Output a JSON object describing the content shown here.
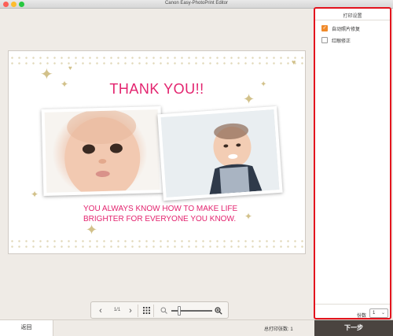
{
  "window": {
    "title": "Canon Easy-PhotoPrint Editor"
  },
  "card": {
    "title": "THANK YOU!!",
    "message_line1": "YOU ALWAYS KNOW HOW TO MAKE LIFE",
    "message_line2": "BRIGHTER FOR EVERYONE YOU KNOW."
  },
  "toolbar": {
    "prev_icon": "chevron-left-icon",
    "page": "1/1",
    "next_icon": "chevron-right-icon",
    "grid_icon": "grid-view-icon",
    "zoom_out_icon": "zoom-out-icon",
    "zoom_in_icon": "zoom-in-icon"
  },
  "panel": {
    "title": "打印设置",
    "options": [
      {
        "label": "自动照片修复",
        "checked": true
      },
      {
        "label": "红眼修正",
        "checked": false
      }
    ],
    "copies_label": "份数",
    "copies_value": "1"
  },
  "bottom": {
    "back_label": "返回",
    "total_label": "总打印张数: 1",
    "next_label": "下一步"
  },
  "colors": {
    "accent": "#e3246f",
    "highlight": "#e3141e",
    "checkbox": "#f08a2a",
    "next_button": "#4a4440"
  }
}
